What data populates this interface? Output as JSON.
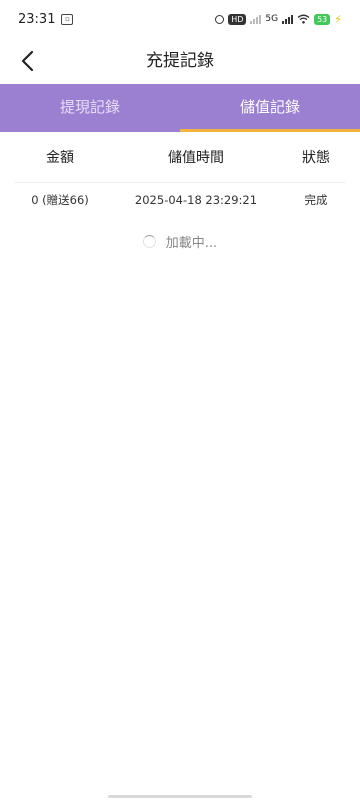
{
  "status_bar": {
    "time": "23:31",
    "network": "5G",
    "battery": "53"
  },
  "nav": {
    "title": "充提記錄"
  },
  "tabs": [
    {
      "label": "提現記錄",
      "active": false
    },
    {
      "label": "儲值記錄",
      "active": true
    }
  ],
  "table": {
    "headers": {
      "amount": "金額",
      "time": "儲值時間",
      "status": "狀態"
    },
    "rows": [
      {
        "amount": "0 (贈送66)",
        "time": "2025-04-18 23:29:21",
        "status": "完成"
      }
    ]
  },
  "loading_text": "加載中...",
  "colors": {
    "tab_bar": "#9b7fd0",
    "tab_indicator": "#f3b43f"
  },
  "icons": {
    "back": "chevron-left-icon",
    "loading": "spinner-icon"
  }
}
